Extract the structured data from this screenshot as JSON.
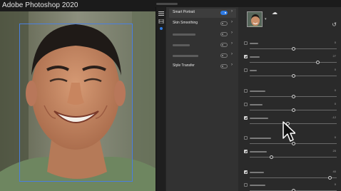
{
  "app": {
    "title": "Adobe Photoshop 2020"
  },
  "filters": [
    {
      "label": "Smart Portrait",
      "enabled": true,
      "active": true
    },
    {
      "label": "Skin Smoothing",
      "enabled": false,
      "active": false
    },
    {
      "label": "",
      "enabled": false,
      "active": false
    },
    {
      "label": "",
      "enabled": false,
      "active": false
    },
    {
      "label": "",
      "enabled": false,
      "active": false
    },
    {
      "label": "Style Transfer",
      "enabled": false,
      "active": false
    }
  ],
  "sliders": [
    {
      "checked": false,
      "value": "0",
      "level": 0.5
    },
    {
      "checked": true,
      "value": "27",
      "level": 0.78
    },
    {
      "checked": false,
      "value": "0",
      "level": 0.5
    },
    {
      "checked": false,
      "value": "0",
      "level": 0.5
    },
    {
      "checked": false,
      "value": "0",
      "level": 0.5
    },
    {
      "checked": true,
      "value": "-12",
      "level": 0.44
    },
    {
      "checked": false,
      "value": "0",
      "level": 0.5
    },
    {
      "checked": true,
      "value": "20",
      "level": 0.25
    },
    {
      "checked": true,
      "value": "40",
      "level": 0.92
    },
    {
      "checked": false,
      "value": "0",
      "level": 0.5
    }
  ],
  "colors": {
    "accent": "#2f7be3",
    "face_box": "#4a7fe0"
  },
  "icons": [
    "cloud-icon",
    "reset-icon",
    "chevron-right-icon",
    "pointer-cursor-icon"
  ]
}
